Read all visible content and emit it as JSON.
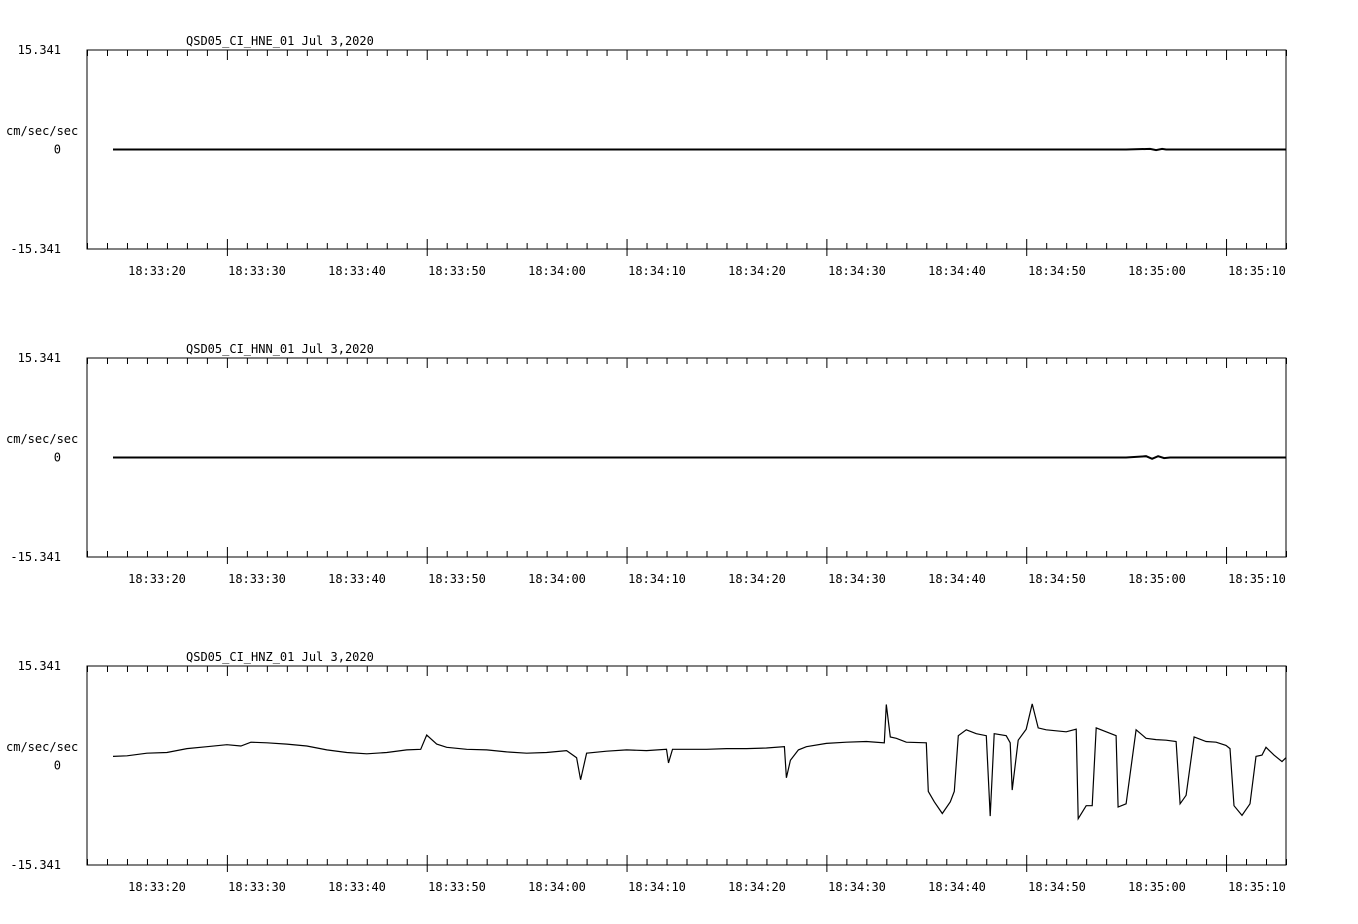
{
  "chart_data": [
    {
      "type": "line",
      "title": "QSD05_CI_HNE_01  Jul 3,2020",
      "ylabel": "cm/sec/sec",
      "ylim": [
        -15.341,
        15.341
      ],
      "y_tick_labels": [
        "15.341",
        "0",
        "-15.341"
      ],
      "x_tick_labels": [
        "18:33:20",
        "18:33:30",
        "18:33:40",
        "18:33:50",
        "18:34:00",
        "18:34:10",
        "18:34:20",
        "18:34:30",
        "18:34:40",
        "18:34:50",
        "18:35:00",
        "18:35:10"
      ],
      "x_range_seconds": [
        13.0,
        73.0
      ],
      "series": [
        {
          "points": [
            [
              14.3,
              0.0
            ],
            [
              20,
              0.0
            ],
            [
              30,
              0.0
            ],
            [
              40,
              0.0
            ],
            [
              50,
              0.0
            ],
            [
              60,
              0.0
            ],
            [
              65,
              0.0
            ],
            [
              66.2,
              0.1
            ],
            [
              66.5,
              -0.1
            ],
            [
              66.8,
              0.1
            ],
            [
              67,
              0.0
            ],
            [
              73,
              0.0
            ]
          ]
        }
      ]
    },
    {
      "type": "line",
      "title": "QSD05_CI_HNN_01  Jul 3,2020",
      "ylabel": "cm/sec/sec",
      "ylim": [
        -15.341,
        15.341
      ],
      "y_tick_labels": [
        "15.341",
        "0",
        "-15.341"
      ],
      "x_tick_labels": [
        "18:33:20",
        "18:33:30",
        "18:33:40",
        "18:33:50",
        "18:34:00",
        "18:34:10",
        "18:34:20",
        "18:34:30",
        "18:34:40",
        "18:34:50",
        "18:35:00",
        "18:35:10"
      ],
      "x_range_seconds": [
        13.0,
        73.0
      ],
      "series": [
        {
          "points": [
            [
              14.3,
              0.0
            ],
            [
              20,
              0.0
            ],
            [
              30,
              0.0
            ],
            [
              40,
              0.0
            ],
            [
              50,
              0.0
            ],
            [
              60,
              0.0
            ],
            [
              65,
              0.0
            ],
            [
              66.0,
              0.2
            ],
            [
              66.3,
              -0.2
            ],
            [
              66.6,
              0.2
            ],
            [
              66.9,
              -0.1
            ],
            [
              67.2,
              0.0
            ],
            [
              73,
              0.0
            ]
          ]
        }
      ]
    },
    {
      "type": "line",
      "title": "QSD05_CI_HNZ_01  Jul 3,2020",
      "ylabel": "cm/sec/sec",
      "ylim": [
        -15.341,
        15.341
      ],
      "y_tick_labels": [
        "15.341",
        "0",
        "-15.341"
      ],
      "x_tick_labels": [
        "18:33:20",
        "18:33:30",
        "18:33:40",
        "18:33:50",
        "18:34:00",
        "18:34:10",
        "18:34:20",
        "18:34:30",
        "18:34:40",
        "18:34:50",
        "18:35:00",
        "18:35:10"
      ],
      "x_range_seconds": [
        13.0,
        73.0
      ],
      "series": [
        {
          "points": [
            [
              14.3,
              1.4
            ],
            [
              15.0,
              1.5
            ],
            [
              16.0,
              1.9
            ],
            [
              17.0,
              2.0
            ],
            [
              18.0,
              2.6
            ],
            [
              19.0,
              2.9
            ],
            [
              20.0,
              3.2
            ],
            [
              20.7,
              3.0
            ],
            [
              21.2,
              3.6
            ],
            [
              22.0,
              3.5
            ],
            [
              23.0,
              3.3
            ],
            [
              24.0,
              3.0
            ],
            [
              25.0,
              2.4
            ],
            [
              26.0,
              2.0
            ],
            [
              27.0,
              1.8
            ],
            [
              28.0,
              2.0
            ],
            [
              29.0,
              2.4
            ],
            [
              29.7,
              2.5
            ],
            [
              30.0,
              4.7
            ],
            [
              30.5,
              3.3
            ],
            [
              31.0,
              2.8
            ],
            [
              32.0,
              2.5
            ],
            [
              33.0,
              2.4
            ],
            [
              34.0,
              2.1
            ],
            [
              35.0,
              1.9
            ],
            [
              36.0,
              2.0
            ],
            [
              37.0,
              2.3
            ],
            [
              37.5,
              1.2
            ],
            [
              37.7,
              -2.2
            ],
            [
              38.0,
              1.9
            ],
            [
              39.0,
              2.2
            ],
            [
              40.0,
              2.4
            ],
            [
              41.0,
              2.3
            ],
            [
              42.0,
              2.5
            ],
            [
              42.1,
              0.4
            ],
            [
              42.3,
              2.5
            ],
            [
              43.0,
              2.5
            ],
            [
              44.0,
              2.5
            ],
            [
              45.0,
              2.6
            ],
            [
              46.0,
              2.6
            ],
            [
              47.0,
              2.7
            ],
            [
              47.9,
              2.9
            ],
            [
              48.0,
              -1.9
            ],
            [
              48.2,
              0.8
            ],
            [
              48.6,
              2.4
            ],
            [
              49.0,
              2.9
            ],
            [
              50.0,
              3.4
            ],
            [
              51.0,
              3.6
            ],
            [
              52.0,
              3.7
            ],
            [
              52.9,
              3.5
            ],
            [
              53.0,
              9.4
            ],
            [
              53.2,
              4.4
            ],
            [
              53.5,
              4.2
            ],
            [
              54.0,
              3.6
            ],
            [
              55.0,
              3.5
            ],
            [
              55.1,
              -4.0
            ],
            [
              55.4,
              -5.6
            ],
            [
              55.8,
              -7.4
            ],
            [
              56.2,
              -5.6
            ],
            [
              56.4,
              -4.0
            ],
            [
              56.6,
              4.6
            ],
            [
              57.0,
              5.5
            ],
            [
              57.5,
              4.9
            ],
            [
              58.0,
              4.6
            ],
            [
              58.2,
              -7.8
            ],
            [
              58.4,
              4.9
            ],
            [
              59.0,
              4.6
            ],
            [
              59.2,
              3.5
            ],
            [
              59.3,
              -3.8
            ],
            [
              59.6,
              3.9
            ],
            [
              60.0,
              5.6
            ],
            [
              60.3,
              9.5
            ],
            [
              60.6,
              5.8
            ],
            [
              61.0,
              5.5
            ],
            [
              62.0,
              5.2
            ],
            [
              62.5,
              5.6
            ],
            [
              62.6,
              -8.2
            ],
            [
              63.0,
              -6.2
            ],
            [
              63.3,
              -6.2
            ],
            [
              63.5,
              5.8
            ],
            [
              64.0,
              5.2
            ],
            [
              64.5,
              4.6
            ],
            [
              64.6,
              -6.4
            ],
            [
              65.0,
              -5.9
            ],
            [
              65.5,
              5.5
            ],
            [
              66.0,
              4.2
            ],
            [
              66.5,
              4.0
            ],
            [
              67.0,
              3.9
            ],
            [
              67.5,
              3.7
            ],
            [
              67.7,
              -5.9
            ],
            [
              68.0,
              -4.6
            ],
            [
              68.4,
              4.4
            ],
            [
              69.0,
              3.7
            ],
            [
              69.5,
              3.6
            ],
            [
              70.0,
              3.1
            ],
            [
              70.2,
              2.6
            ],
            [
              70.4,
              -6.2
            ],
            [
              70.8,
              -7.7
            ],
            [
              71.2,
              -5.9
            ],
            [
              71.5,
              1.4
            ],
            [
              71.8,
              1.6
            ],
            [
              72.0,
              2.8
            ],
            [
              72.4,
              1.6
            ],
            [
              72.8,
              0.6
            ],
            [
              73.0,
              1.2
            ]
          ]
        }
      ]
    }
  ]
}
